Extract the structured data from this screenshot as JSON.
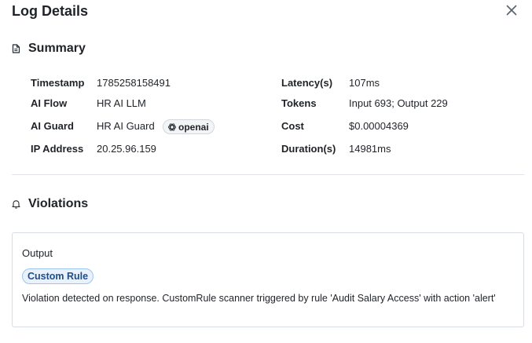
{
  "dialog": {
    "title": "Log Details",
    "close_icon": "close-icon"
  },
  "summary": {
    "heading": "Summary",
    "icon": "document-icon",
    "fields": {
      "timestamp_label": "Timestamp",
      "timestamp_value": "1785258158491",
      "ai_flow_label": "AI Flow",
      "ai_flow_value": "HR AI LLM",
      "ai_guard_label": "AI Guard",
      "ai_guard_value": "HR AI Guard",
      "ai_guard_provider": "openai",
      "ai_guard_provider_icon": "openai-icon",
      "ip_label": "IP Address",
      "ip_value": "20.25.96.159",
      "latency_label": "Latency(s)",
      "latency_value": "107ms",
      "tokens_label": "Tokens",
      "tokens_value": "Input 693; Output 229",
      "cost_label": "Cost",
      "cost_value": "$0.00004369",
      "duration_label": "Duration(s)",
      "duration_value": "14981ms"
    }
  },
  "violations": {
    "heading": "Violations",
    "icon": "bell-icon",
    "items": [
      {
        "stage": "Output",
        "rule": "Custom Rule",
        "message": "Violation detected on response. CustomRule scanner triggered by rule 'Audit Salary Access' with action 'alert'"
      }
    ]
  },
  "colors": {
    "badge_bg": "#e8f1fc",
    "badge_border": "#9ec5f0",
    "badge_text": "#1d4e8a",
    "divider": "#e1e4e8"
  }
}
